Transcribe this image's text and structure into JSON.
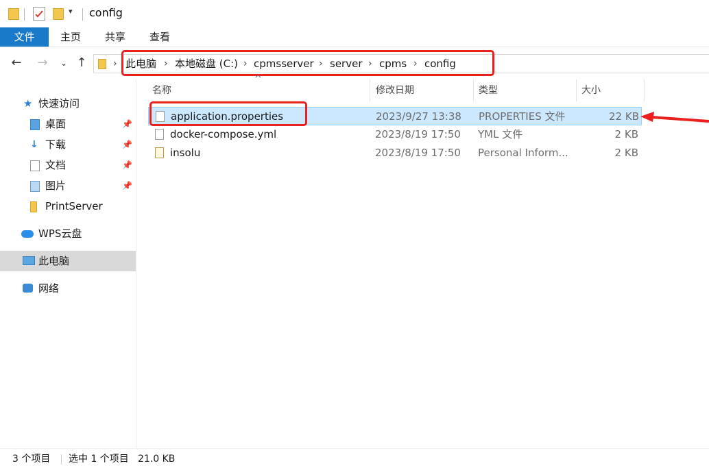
{
  "titlebar": {
    "window_title": "config",
    "qat_icons": [
      "folder-icon",
      "properties-check-icon",
      "new-folder-icon",
      "customize-dropdown-icon"
    ]
  },
  "ribbon": {
    "tabs": [
      "文件",
      "主页",
      "共享",
      "查看"
    ]
  },
  "address": {
    "nav_icons": [
      "back-arrow-icon",
      "forward-arrow-icon",
      "recent-dropdown-icon",
      "up-arrow-icon"
    ],
    "breadcrumb": [
      "此电脑",
      "本地磁盘 (C:)",
      "cpmsserver",
      "server",
      "cpms",
      "config"
    ]
  },
  "sidebar": {
    "items": [
      {
        "label": "快速访问",
        "icon": "star-icon"
      },
      {
        "label": "桌面",
        "icon": "desktop-folder-icon",
        "pinned": true
      },
      {
        "label": "下载",
        "icon": "download-folder-icon",
        "pinned": true
      },
      {
        "label": "文档",
        "icon": "documents-folder-icon",
        "pinned": true
      },
      {
        "label": "图片",
        "icon": "pictures-folder-icon",
        "pinned": true
      },
      {
        "label": "PrintServer",
        "icon": "folder-icon",
        "pinned": false
      },
      {
        "label": "WPS云盘",
        "icon": "cloud-icon"
      },
      {
        "label": "此电脑",
        "icon": "computer-icon",
        "selected": true
      },
      {
        "label": "网络",
        "icon": "network-icon"
      }
    ]
  },
  "list": {
    "columns": [
      "名称",
      "修改日期",
      "类型",
      "大小"
    ],
    "sort_indicator": "^",
    "rows": [
      {
        "name": "application.properties",
        "date": "2023/9/27 13:38",
        "type": "PROPERTIES 文件",
        "size": "22 KB",
        "selected": true
      },
      {
        "name": "docker-compose.yml",
        "date": "2023/8/19 17:50",
        "type": "YML 文件",
        "size": "2 KB",
        "selected": false
      },
      {
        "name": "insolu",
        "date": "2023/8/19 17:50",
        "type": "Personal Inform...",
        "size": "2 KB",
        "selected": false
      }
    ]
  },
  "status": {
    "item_count": "3 个项目",
    "selection": "选中 1 个项目",
    "selection_size": "21.0 KB"
  },
  "colors": {
    "accent": "#1979ca",
    "selection_bg": "#cce8ff",
    "annotation_red": "#e8201e"
  }
}
